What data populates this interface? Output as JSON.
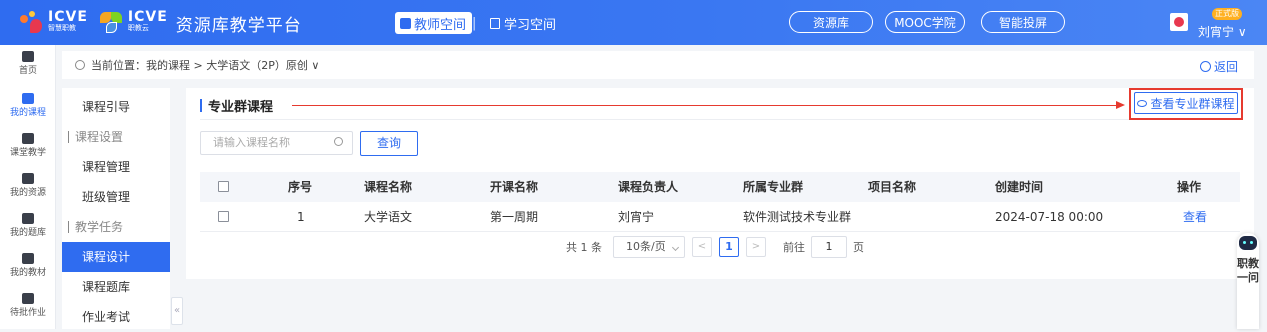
{
  "header": {
    "logo1_text": "ICVE",
    "logo1_sub": "智慧职教",
    "logo2_text": "ICVE",
    "logo2_sub": "职教云",
    "platform_title": "资源库教学平台",
    "nav_teacher": "教师空间",
    "nav_separator": "|",
    "nav_student": "学习空间",
    "pills": [
      "资源库",
      "MOOC学院",
      "智能投屏"
    ],
    "user_badge": "正式版",
    "user_name": "刘宵宁"
  },
  "leftnav": {
    "items": [
      {
        "label": "首页",
        "icon": "home-icon"
      },
      {
        "label": "我的课程",
        "icon": "book-icon"
      },
      {
        "label": "课堂教学",
        "icon": "play-icon"
      },
      {
        "label": "我的资源",
        "icon": "resource-icon"
      },
      {
        "label": "我的题库",
        "icon": "question-bank-icon"
      },
      {
        "label": "我的教材",
        "icon": "textbook-icon"
      },
      {
        "label": "待批作业",
        "icon": "homework-icon"
      }
    ]
  },
  "breadcrumb": {
    "text": "当前位置：我的课程 > 大学语文（2P）原创 ∨",
    "back": "返回"
  },
  "sidenav": {
    "items": [
      "课程引导",
      "课程设置",
      "课程管理",
      "班级管理",
      "教学任务",
      "课程设计",
      "课程题库",
      "作业考试"
    ]
  },
  "section": {
    "title": "专业群课程",
    "view_button": "查看专业群课程"
  },
  "search": {
    "placeholder": "请输入课程名称",
    "button": "查询"
  },
  "table": {
    "columns": [
      "序号",
      "课程名称",
      "开课名称",
      "课程负责人",
      "所属专业群",
      "项目名称",
      "创建时间",
      "操作"
    ],
    "rows": [
      {
        "index": "1",
        "course": "大学语文",
        "term": "第一周期",
        "owner": "刘宵宁",
        "group": "软件测试技术专业群",
        "project": "",
        "created": "2024-07-18 00:00",
        "action": "查看"
      }
    ]
  },
  "pager": {
    "total": "共 1 条",
    "size": "10条/页",
    "prev": "<",
    "page": "1",
    "next": ">",
    "goto": "前往",
    "goto_value": "1",
    "goto_suffix": "页"
  },
  "bot": {
    "text": "职教一问"
  },
  "colors": {
    "accent": "#2f6cf0",
    "highlight": "#e63a2f"
  }
}
